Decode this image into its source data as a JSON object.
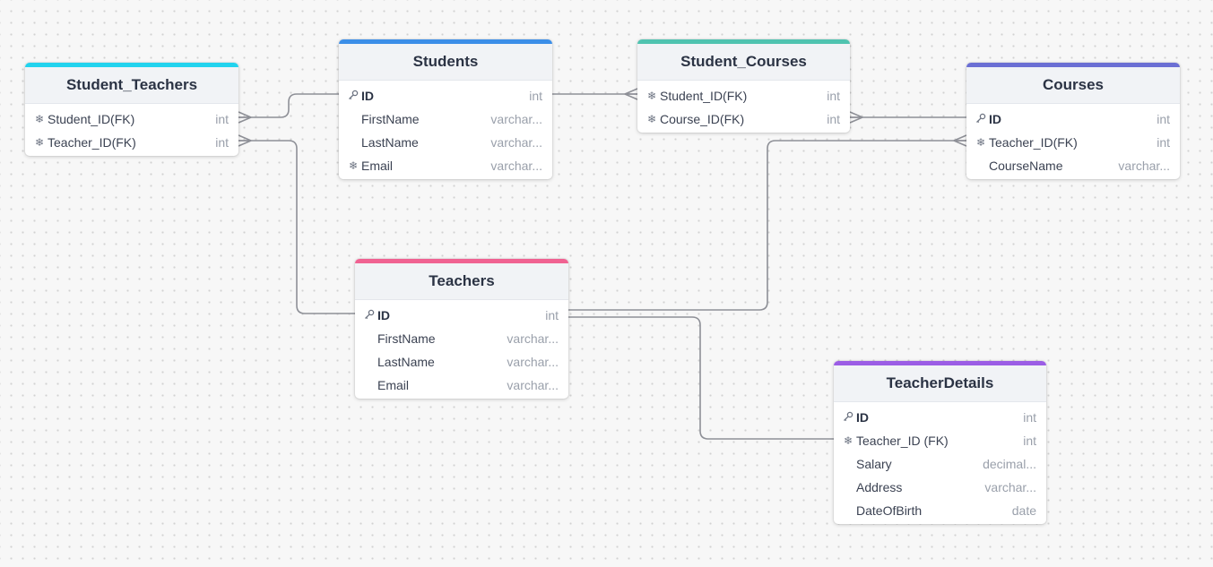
{
  "diagram": {
    "tables": [
      {
        "id": "Student_Teachers",
        "title": "Student_Teachers",
        "accent": "#22d3ee",
        "fields": [
          {
            "name": "Student_ID(FK)",
            "type": "int",
            "icon": "fk-icon"
          },
          {
            "name": "Teacher_ID(FK)",
            "type": "int",
            "icon": "fk-icon"
          }
        ]
      },
      {
        "id": "Students",
        "title": "Students",
        "accent": "#3b8ee8",
        "fields": [
          {
            "name": "ID",
            "type": "int",
            "icon": "pk-icon"
          },
          {
            "name": "FirstName",
            "type": "varchar...",
            "icon": ""
          },
          {
            "name": "LastName",
            "type": "varchar...",
            "icon": ""
          },
          {
            "name": "Email",
            "type": "varchar...",
            "icon": "fk-icon"
          }
        ]
      },
      {
        "id": "Student_Courses",
        "title": "Student_Courses",
        "accent": "#4fc3b0",
        "fields": [
          {
            "name": "Student_ID(FK)",
            "type": "int",
            "icon": "fk-icon"
          },
          {
            "name": "Course_ID(FK)",
            "type": "int",
            "icon": "fk-icon"
          }
        ]
      },
      {
        "id": "Courses",
        "title": "Courses",
        "accent": "#6b6fd4",
        "fields": [
          {
            "name": "ID",
            "type": "int",
            "icon": "pk-icon"
          },
          {
            "name": "Teacher_ID(FK)",
            "type": "int",
            "icon": "fk-icon"
          },
          {
            "name": "CourseName",
            "type": "varchar...",
            "icon": ""
          }
        ]
      },
      {
        "id": "Teachers",
        "title": "Teachers",
        "accent": "#f06292",
        "fields": [
          {
            "name": "ID",
            "type": "int",
            "icon": "pk-icon"
          },
          {
            "name": "FirstName",
            "type": "varchar...",
            "icon": ""
          },
          {
            "name": "LastName",
            "type": "varchar...",
            "icon": ""
          },
          {
            "name": "Email",
            "type": "varchar...",
            "icon": ""
          }
        ]
      },
      {
        "id": "TeacherDetails",
        "title": "TeacherDetails",
        "accent": "#9b5de5",
        "fields": [
          {
            "name": "ID",
            "type": "int",
            "icon": "pk-icon"
          },
          {
            "name": "Teacher_ID (FK)",
            "type": "int",
            "icon": "fk-icon"
          },
          {
            "name": "Salary",
            "type": "decimal...",
            "icon": ""
          },
          {
            "name": "Address",
            "type": "varchar...",
            "icon": ""
          },
          {
            "name": "DateOfBirth",
            "type": "date",
            "icon": ""
          }
        ]
      }
    ],
    "relations": [
      {
        "from": "Student_Teachers.Student_ID(FK)",
        "to": "Students.ID",
        "cardinality": "many-to-one"
      },
      {
        "from": "Student_Teachers.Teacher_ID(FK)",
        "to": "Teachers.ID",
        "cardinality": "many-to-one"
      },
      {
        "from": "Student_Courses.Student_ID(FK)",
        "to": "Students.ID",
        "cardinality": "many-to-one"
      },
      {
        "from": "Student_Courses.Course_ID(FK)",
        "to": "Courses.ID",
        "cardinality": "many-to-one"
      },
      {
        "from": "Courses.Teacher_ID(FK)",
        "to": "Teachers.ID",
        "cardinality": "many-to-one"
      },
      {
        "from": "TeacherDetails.Teacher_ID (FK)",
        "to": "Teachers.ID",
        "cardinality": "one-to-one"
      }
    ],
    "line_color": "#8e9097"
  }
}
